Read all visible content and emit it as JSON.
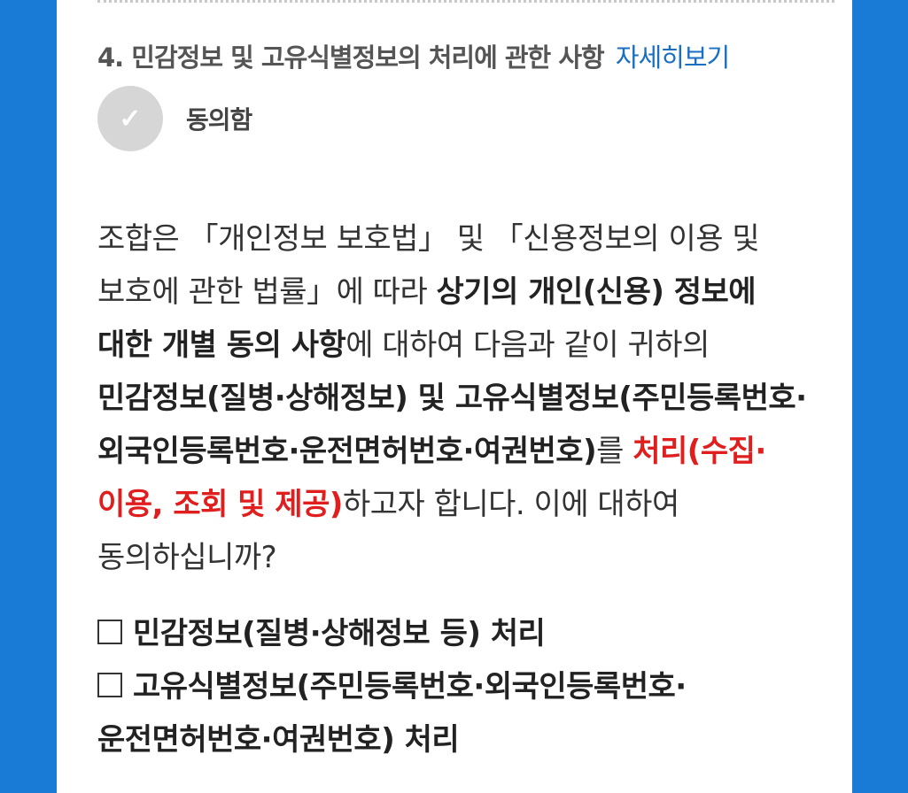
{
  "section": {
    "title": "4. 민감정보 및 고유식별정보의 처리에 관한 사항",
    "detail_link": "자세히보기"
  },
  "agree": {
    "check_glyph": "✓",
    "label": "동의함"
  },
  "body": {
    "p1": "조합은 「개인정보 보호법」 및 「신용정보의 이용 및 보호에 관한 법률」에 따라 ",
    "b1": "상기의 개인(신용) 정보에 대한 개별 동의 사항",
    "p2": "에 대하여 다음과 같이 귀하의 ",
    "b2": "민감정보(질병·상해정보) 및 고유식별정보(주민등록번호·외국인등록번호·운전면허번호·여권번호)",
    "p3": "를 ",
    "red": "처리(수집·이용, 조회 및 제공)",
    "p4": "하고자 합니다. 이에 대하여 동의하십니까?"
  },
  "options": [
    {
      "label": "민감정보(질병·상해정보 등) 처리"
    },
    {
      "label": "고유식별정보(주민등록번호·외국인등록번호·운전면허번호·여권번호) 처리"
    }
  ],
  "colors": {
    "background": "#1a7bd6",
    "link": "#1a6fc0",
    "emphasis_red": "#e01e1e",
    "check_circle": "#d6d6d6"
  }
}
